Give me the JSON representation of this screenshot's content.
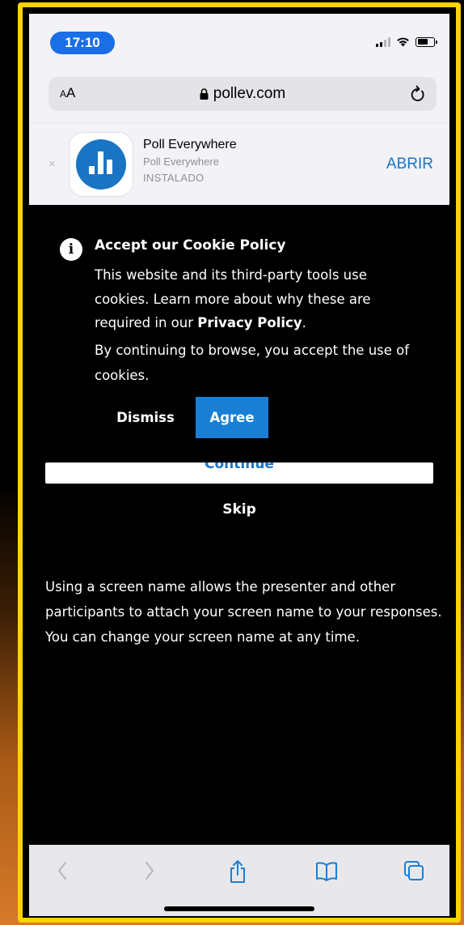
{
  "status_bar": {
    "time": "17:10"
  },
  "url_bar": {
    "aa_label_small": "A",
    "aa_label_large": "A",
    "domain": "pollev.com"
  },
  "app_banner": {
    "close_symbol": "×",
    "app_name": "Poll Everywhere",
    "developer": "Poll Everywhere",
    "install_status": "INSTALADO",
    "open_label": "ABRIR"
  },
  "cookie_banner": {
    "info_icon_glyph": "i",
    "title": "Accept our Cookie Policy",
    "text_before_link": "This website and its third-party tools use cookies. Learn more about why these are required in our ",
    "privacy_link": "Privacy Policy",
    "text_after_link": ".",
    "browse_notice": "By continuing to browse, you accept the use of cookies.",
    "dismiss_label": "Dismiss",
    "agree_label": "Agree"
  },
  "form": {
    "continue_label": "Continue",
    "skip_label": "Skip",
    "help_text": "Using a screen name allows the presenter and other participants to attach your screen name to your responses. You can change your screen name at any time."
  },
  "toolbar": {
    "icons": [
      "back-icon",
      "forward-icon",
      "share-icon",
      "bookmarks-icon",
      "tabs-icon"
    ]
  },
  "colors": {
    "frame": "#ffd200",
    "accent_blue": "#1a7fd4",
    "time_pill": "#1a6ee6",
    "content_bg": "#000000",
    "chrome_bg": "#f2f2f7"
  }
}
